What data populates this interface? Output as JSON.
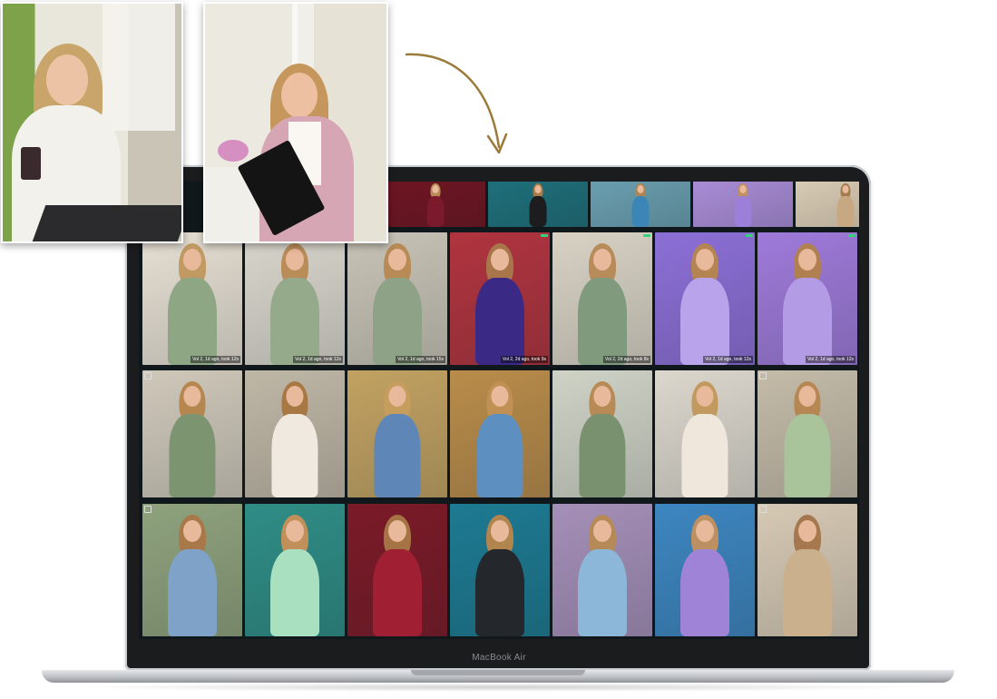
{
  "device": {
    "label": "MacBook Air"
  },
  "colors": {
    "bezel": "#1b1c1e",
    "screen_bg": "#11181c",
    "arrow": "#9c7b3a"
  },
  "rows": [
    {
      "tiles": [
        {
          "bg": "#6f1522",
          "outfit": "#7a1a2b",
          "hair": "#b88a55"
        },
        {
          "bg": "#1e6f7a",
          "outfit": "#1d1d1f",
          "hair": "#a87a48"
        },
        {
          "bg": "#6a9fb0",
          "outfit": "#3b86b6",
          "hair": "#b0844e"
        },
        {
          "bg": "#a98cd6",
          "outfit": "#9c7fd8",
          "hair": "#c09060"
        },
        {
          "bg": "#d9cbb4",
          "outfit": "#c7a882",
          "hair": "#a47a4e"
        }
      ]
    },
    {
      "tiles": [
        {
          "bg": "#e6dfd3",
          "outfit": "#8fa685",
          "hair": "#c09a62"
        },
        {
          "bg": "#d9d6cc",
          "outfit": "#95a98b",
          "hair": "#b98c58"
        },
        {
          "bg": "#c8c3b6",
          "outfit": "#8ea287",
          "hair": "#b88a56"
        },
        {
          "bg": "#b0343f",
          "outfit": "#3a2a85",
          "hair": "#a8764a"
        },
        {
          "bg": "#d8d2c4",
          "outfit": "#7f9a7d",
          "hair": "#b88c5a"
        },
        {
          "bg": "#8c6fd6",
          "outfit": "#b9a3ea",
          "hair": "#b48552"
        },
        {
          "bg": "#9e7ad9",
          "outfit": "#b49be6",
          "hair": "#b08050"
        }
      ]
    },
    {
      "tiles": [
        {
          "bg": "#cfc8ba",
          "outfit": "#7c946f",
          "hair": "#b5874f"
        },
        {
          "bg": "#bfb7a6",
          "outfit": "#efe9df",
          "hair": "#a87844"
        },
        {
          "bg": "#c2a262",
          "outfit": "#5e86b6",
          "hair": "#c79d5e"
        },
        {
          "bg": "#b98c4a",
          "outfit": "#5d8fc0",
          "hair": "#c09055"
        },
        {
          "bg": "#cfd3c6",
          "outfit": "#7a9170",
          "hair": "#b88a55"
        },
        {
          "bg": "#dcd7cd",
          "outfit": "#efe6dc",
          "hair": "#c29a60"
        },
        {
          "bg": "#c4bba8",
          "outfit": "#a9c49a",
          "hair": "#b68753"
        }
      ]
    },
    {
      "tiles": [
        {
          "bg": "#8fa27d",
          "outfit": "#7fa2c8",
          "hair": "#a87848"
        },
        {
          "bg": "#2f8d86",
          "outfit": "#a8e0c0",
          "hair": "#c08f5a"
        },
        {
          "bg": "#7b1a28",
          "outfit": "#a01f33",
          "hair": "#a67444"
        },
        {
          "bg": "#1d7a92",
          "outfit": "#24272b",
          "hair": "#b2844e"
        },
        {
          "bg": "#a58fb8",
          "outfit": "#8db7d8",
          "hair": "#b58a57"
        },
        {
          "bg": "#3d86c0",
          "outfit": "#9f83d6",
          "hair": "#bc9060"
        },
        {
          "bg": "#d6c9b4",
          "outfit": "#cbb08d",
          "hair": "#a67850"
        }
      ]
    }
  ],
  "captions": [
    "Vol 2, 1d ago, took 12s",
    "Vol 2, 1d ago, took 12s",
    "Vol 2, 1d ago, took 15s",
    "Vol 2, 2d ago, took 9s",
    "Vol 2, 2d ago, took 8s"
  ]
}
